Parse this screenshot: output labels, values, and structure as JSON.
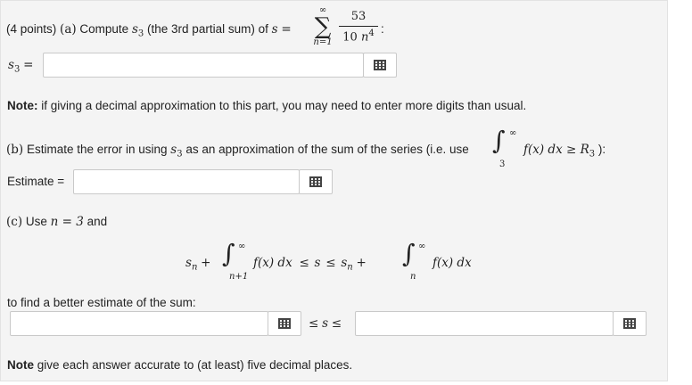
{
  "part_a": {
    "points": "(4 points)",
    "label": "(a)",
    "prompt": "Compute",
    "s3": "s",
    "sub3": "3",
    "mid": "(the 3rd partial sum) of",
    "s": "s",
    "eq": "=",
    "sum_upper": "∞",
    "sum_lower": "n=1",
    "numerator": "53",
    "den_prefix": "10",
    "den_n": "n",
    "den_exp": "4",
    "tail": ":",
    "answer_label_s": "s",
    "answer_label_sub": "3",
    "answer_label_eq": "=",
    "input_value": ""
  },
  "note1": {
    "bold": "Note:",
    "text": " if giving a decimal approximation to this part, you may need to enter more digits than usual."
  },
  "part_b": {
    "label": "(b)",
    "text1": "Estimate the error in using",
    "s": "s",
    "sub3": "3",
    "text2": "as an approximation of the sum of the series (i.e. use",
    "int_upper": "∞",
    "int_lower": "3",
    "integrand": "f(x) dx ≥ R",
    "r_sub": "3",
    "close": "):",
    "estimate_label": "Estimate =",
    "input_value": ""
  },
  "part_c": {
    "label": "(c)",
    "text1": "Use",
    "n_eq": "n = 3",
    "text2": "and",
    "sn": "s",
    "sn_sub": "n",
    "plus": "+",
    "int1_upper": "∞",
    "int1_lower": "n+1",
    "integrand": "f(x) dx",
    "leq": "≤",
    "s": "s",
    "int2_upper": "∞",
    "int2_lower": "n",
    "find_text": "to find a better estimate of the sum:",
    "between_s": "s",
    "lower_value": "",
    "upper_value": ""
  },
  "note2": {
    "bold": "Note",
    "text": " give each answer accurate to (at least) five decimal places."
  },
  "icons": {
    "keyboard": "keyboard-grid-icon"
  }
}
